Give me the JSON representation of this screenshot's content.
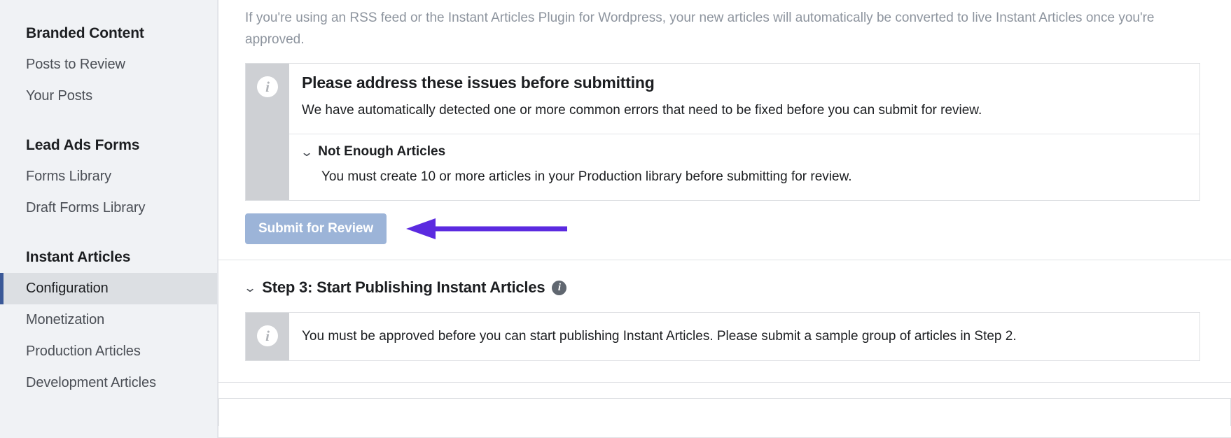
{
  "sidebar": {
    "groups": [
      {
        "heading": "Branded Content",
        "items": [
          {
            "label": "Posts to Review",
            "active": false
          },
          {
            "label": "Your Posts",
            "active": false
          }
        ]
      },
      {
        "heading": "Lead Ads Forms",
        "items": [
          {
            "label": "Forms Library",
            "active": false
          },
          {
            "label": "Draft Forms Library",
            "active": false
          }
        ]
      },
      {
        "heading": "Instant Articles",
        "items": [
          {
            "label": "Configuration",
            "active": true
          },
          {
            "label": "Monetization",
            "active": false
          },
          {
            "label": "Production Articles",
            "active": false
          },
          {
            "label": "Development Articles",
            "active": false
          }
        ]
      }
    ]
  },
  "main": {
    "intro_text": "If you're using an RSS feed or the Instant Articles Plugin for Wordpress, your new articles will automatically be converted to live Instant Articles once you're approved.",
    "alert": {
      "icon": "info-icon",
      "title": "Please address these issues before submitting",
      "description": "We have automatically detected one or more common errors that need to be fixed before you can submit for review.",
      "issues": [
        {
          "chevron": "chevron-down-icon",
          "title": "Not Enough Articles",
          "description": "You must create 10 or more articles in your Production library before submitting for review."
        }
      ]
    },
    "submit_button": {
      "label": "Submit for Review",
      "disabled": true,
      "color": "#9cb4d8"
    },
    "annotation_arrow": {
      "name": "annotation-arrow",
      "color": "#5b2ae0",
      "direction": "left"
    },
    "step3": {
      "chevron": "chevron-down-icon",
      "title": "Step 3: Start Publishing Instant Articles",
      "info_icon": "info-icon",
      "note": {
        "icon": "info-icon",
        "text": "You must be approved before you can start publishing Instant Articles. Please submit a sample group of articles in Step 2."
      }
    }
  }
}
